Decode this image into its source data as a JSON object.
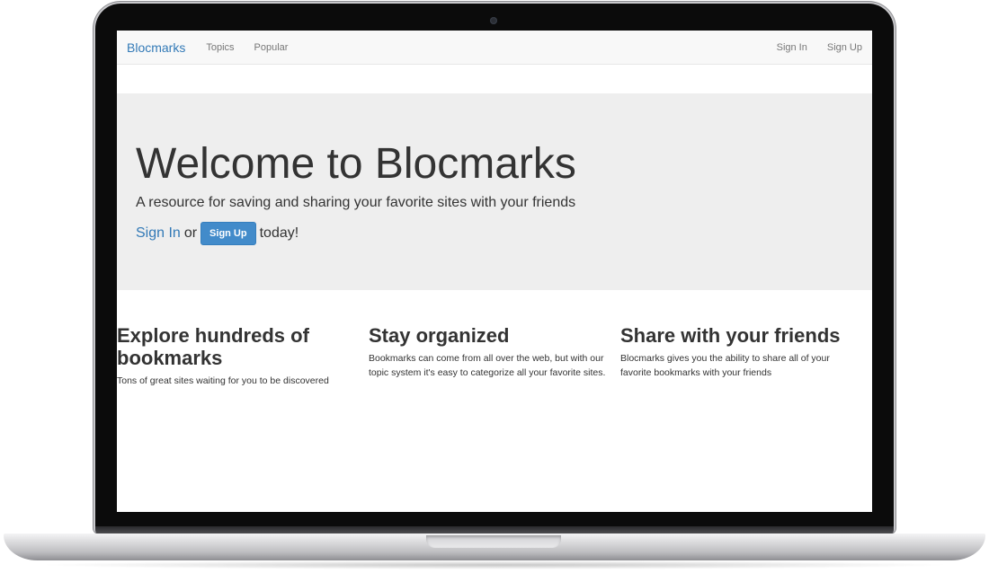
{
  "navbar": {
    "brand": "Blocmarks",
    "links": [
      "Topics",
      "Popular"
    ],
    "right_links": [
      "Sign In",
      "Sign Up"
    ]
  },
  "hero": {
    "title": "Welcome to Blocmarks",
    "subtitle": "A resource for saving and sharing your favorite sites with your friends",
    "signin_link": "Sign In",
    "or_text": "or",
    "signup_button": "Sign Up",
    "today_text": "today!"
  },
  "features": [
    {
      "title": "Explore hundreds of bookmarks",
      "text": "Tons of great sites waiting for you to be discovered"
    },
    {
      "title": "Stay organized",
      "text": "Bookmarks can come from all over the web, but with our topic system it's easy to categorize all your favorite sites."
    },
    {
      "title": "Share with your friends",
      "text": "Blocmarks gives you the ability to share all of your favorite bookmarks with your friends"
    }
  ],
  "colors": {
    "brand": "#337ab7",
    "button": "#428bca",
    "jumbotron_bg": "#eeeeee"
  }
}
